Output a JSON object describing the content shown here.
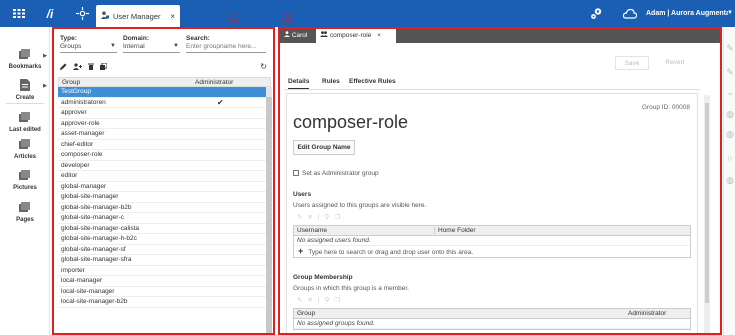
{
  "topbar": {
    "logo": "/i",
    "tab_label": "User Manager",
    "tab_close": "×",
    "user_name": "Adam | Aurora Augmentation | Eng...",
    "user_caret": "▼"
  },
  "leftnav": {
    "items": [
      {
        "label": "Bookmarks"
      },
      {
        "label": "Create"
      },
      {
        "label": "Last edited"
      },
      {
        "label": "Articles"
      },
      {
        "label": "Pictures"
      },
      {
        "label": "Pages"
      }
    ]
  },
  "regions": {
    "left": "(1)",
    "right": "(2)"
  },
  "groups_panel": {
    "type_label": "Type:",
    "type_value": "Groups",
    "domain_label": "Domain:",
    "domain_value": "Internal",
    "search_label": "Search:",
    "search_placeholder": "Enter groupname here...",
    "col_group": "Group",
    "col_admin": "Administrator",
    "rows": [
      {
        "name": "TestGroup",
        "selected": true
      },
      {
        "name": "administratoren",
        "admin": "✔"
      },
      {
        "name": "approver"
      },
      {
        "name": "approver-role"
      },
      {
        "name": "asset-manager"
      },
      {
        "name": "chief-editor"
      },
      {
        "name": "composer-role"
      },
      {
        "name": "developer"
      },
      {
        "name": "editor"
      },
      {
        "name": "global-manager"
      },
      {
        "name": "global-site-manager"
      },
      {
        "name": "global-site-manager-b2b"
      },
      {
        "name": "global-site-manager-c"
      },
      {
        "name": "global-site-manager-calista"
      },
      {
        "name": "global-site-manager-h-b2c"
      },
      {
        "name": "global-site-manager-sf"
      },
      {
        "name": "global-site-manager-sfra"
      },
      {
        "name": "importer"
      },
      {
        "name": "local-manager"
      },
      {
        "name": "local-site-manager"
      },
      {
        "name": "local-site-manager-b2b"
      }
    ]
  },
  "detail": {
    "tabs": [
      {
        "label": "Carol",
        "active": false
      },
      {
        "label": "composer-role",
        "active": true,
        "close": "×"
      }
    ],
    "save_label": "Save",
    "revert_label": "Revert",
    "subtabs": [
      "Details",
      "Rules",
      "Effective Rules"
    ],
    "group_id": "Group ID: 00008",
    "title": "composer-role",
    "edit_button": "Edit Group Name",
    "admin_checkbox": "Set as Administrator group",
    "users": {
      "title": "Users",
      "desc": "Users assigned to this groups are visible here.",
      "col_username": "Username",
      "col_home": "Home Folder",
      "empty": "No assigned users found.",
      "add_hint": "Type here to search or drag and drop user onto this area."
    },
    "membership": {
      "title": "Group Membership",
      "desc": "Groups in which this group is a member.",
      "col_group": "Group",
      "col_admin": "Administrator",
      "empty": "No assigned groups found."
    }
  }
}
